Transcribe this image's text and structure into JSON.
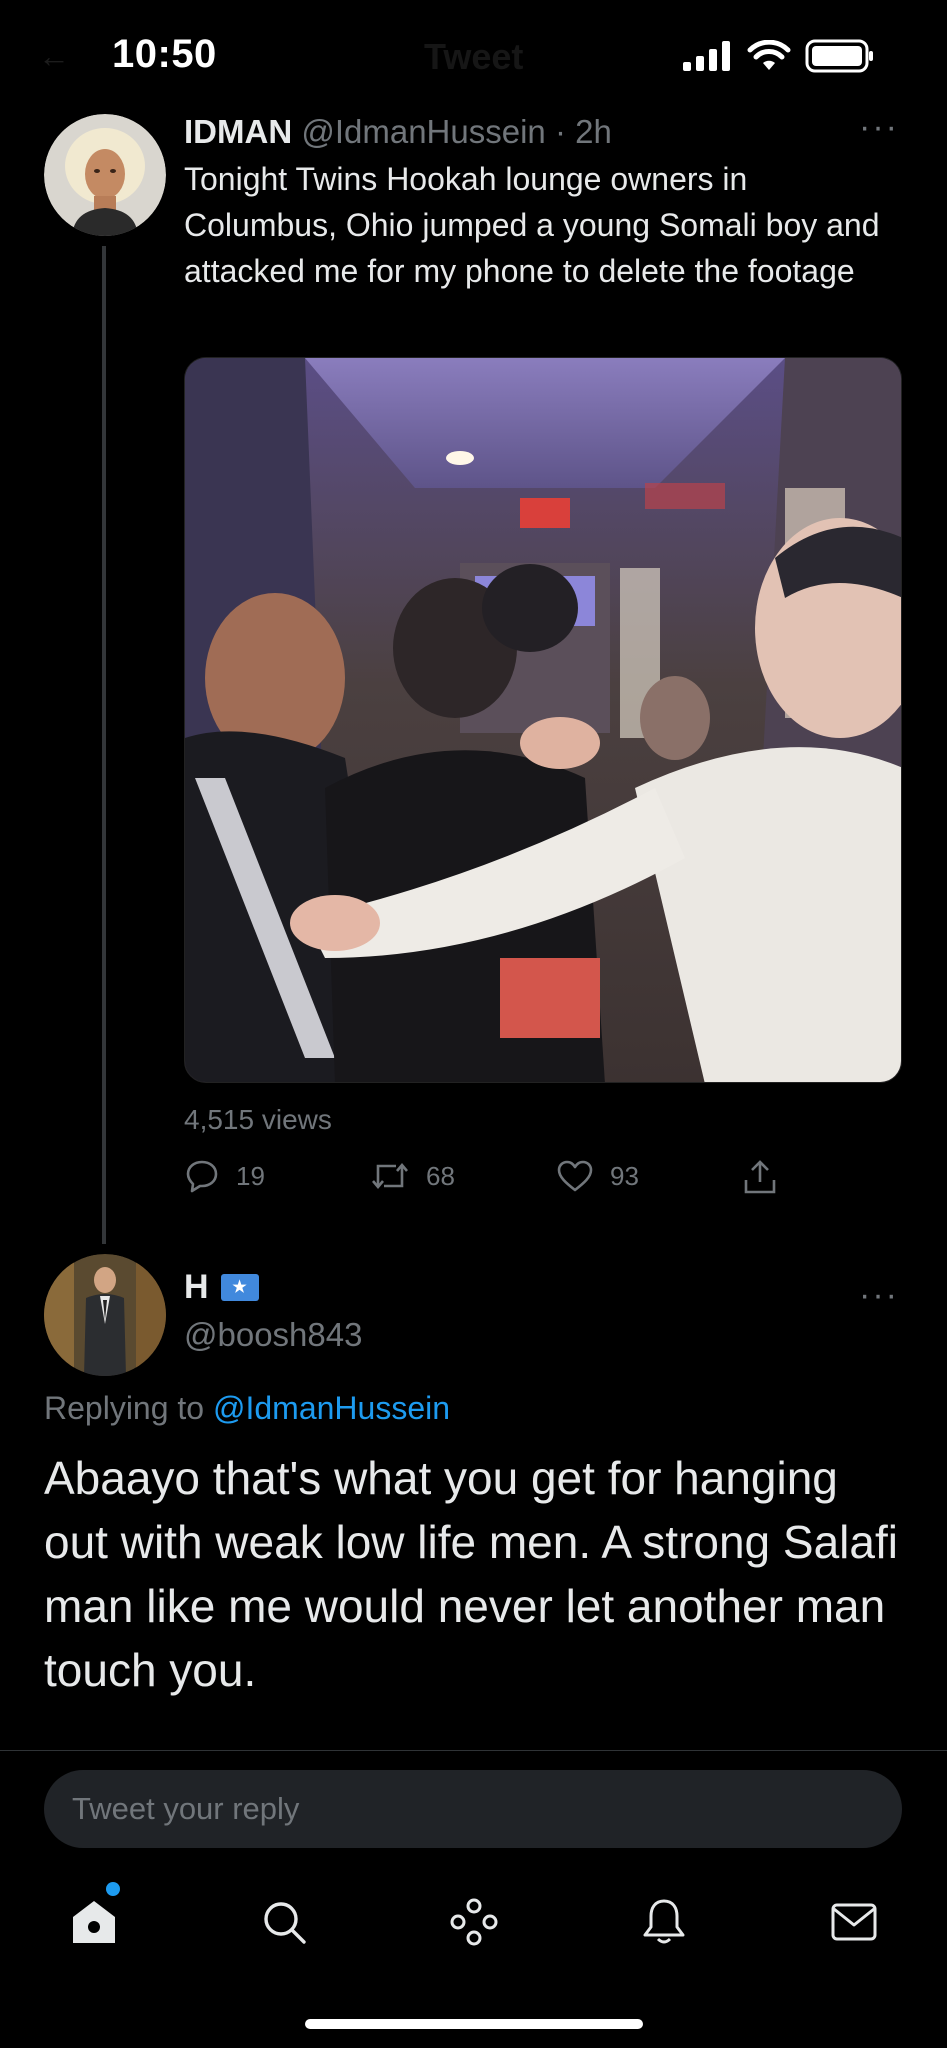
{
  "status_bar": {
    "time": "10:50",
    "ghost_back": "←",
    "ghost_title": "Tweet"
  },
  "tweet": {
    "author_name": "IDMAN",
    "author_handle": "@IdmanHussein",
    "time_ago": "· 2h",
    "more": "···",
    "text": "Tonight Twins Hookah lounge owners in Columbus, Ohio jumped a young Somali boy and attacked me for my phone to delete the footage",
    "views": "4,515 views",
    "replies": "19",
    "retweets": "68",
    "likes": "93"
  },
  "reply": {
    "author_name": "H",
    "author_handle": "@boosh843",
    "more": "···",
    "replying_prefix": "Replying to ",
    "replying_to": "@IdmanHussein",
    "text": "Abaayo that's what you get for hanging out with weak low life men.  A strong Salafi man like me would never let another man touch you."
  },
  "composer": {
    "placeholder": "Tweet your reply"
  },
  "tabbar": {
    "icons": [
      "home-icon",
      "search-icon",
      "spaces-icon",
      "notifications-icon",
      "messages-icon"
    ],
    "has_notification_dot": true
  },
  "colors": {
    "background": "#000000",
    "accent": "#1d9bf0",
    "secondary_text": "#71767b",
    "primary_text": "#e7e9ea"
  }
}
